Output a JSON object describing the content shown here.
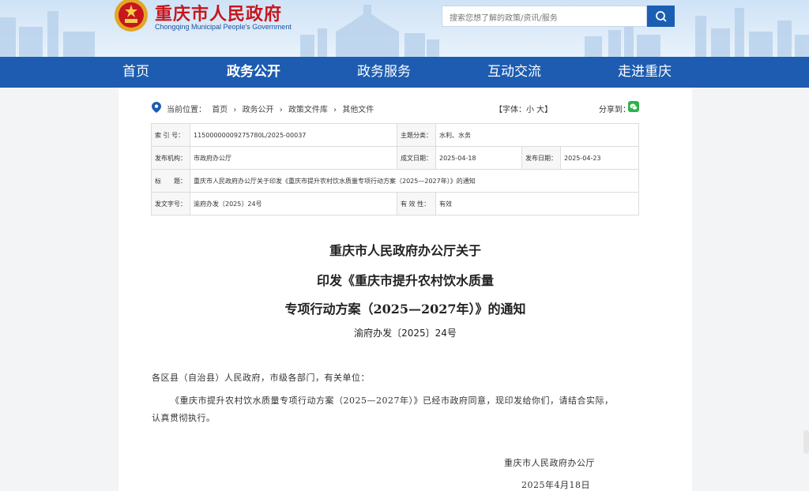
{
  "header": {
    "title": "重庆市人民政府",
    "subtitle": "Chongqing Municipal People's Government",
    "search_placeholder": "搜索您想了解的政策/资讯/服务"
  },
  "nav": {
    "items": [
      {
        "label": "首页",
        "active": false
      },
      {
        "label": "政务公开",
        "active": true
      },
      {
        "label": "政务服务",
        "active": false
      },
      {
        "label": "互动交流",
        "active": false
      },
      {
        "label": "走进重庆",
        "active": false
      }
    ]
  },
  "breadcrumb": {
    "prefix": "当前位置：",
    "items": [
      "首页",
      "›",
      "政务公开",
      "›",
      "政策文件库",
      "›",
      "其他文件"
    ]
  },
  "tools": {
    "font_size": "【字体：小 大】",
    "share_label": "分享到："
  },
  "meta": {
    "index_label": "索 引 号：",
    "index_value": "11500000009275780L/2025-00037",
    "category_label": "主题分类：",
    "category_value": "水利、水务",
    "issuer_label": "发布机构：",
    "issuer_value": "市政府办公厅",
    "written_label": "成文日期：",
    "written_value": "2025-04-18",
    "published_label": "发布日期：",
    "published_value": "2025-04-23",
    "title_label": "标　　题：",
    "title_value": "重庆市人民政府办公厅关于印发《重庆市提升农村饮水质量专项行动方案（2025—2027年）》的通知",
    "docno_label": "发文字号：",
    "docno_value": "渝府办发〔2025〕24号",
    "validity_label": "有 效 性：",
    "validity_value": "有效"
  },
  "document": {
    "title_line1": "重庆市人民政府办公厅关于",
    "title_line2": "印发《重庆市提升农村饮水质量",
    "title_line3": "专项行动方案（2025—2027年）》的通知",
    "doc_number": "渝府办发〔2025〕24号",
    "salutation": "各区县（自治县）人民政府，市级各部门，有关单位：",
    "body_line1": "《重庆市提升农村饮水质量专项行动方案（2025—2027年）》已经市政府同意，现印发给你们，请结合实际，",
    "body_line2": "认真贯彻执行。",
    "signature": "重庆市人民政府办公厅",
    "date": "2025年4月18日"
  },
  "colors": {
    "brand_red": "#c8161d",
    "nav_blue": "#1d5cb0",
    "search_blue": "#1a5fb4",
    "wechat_green": "#2cb34a"
  }
}
